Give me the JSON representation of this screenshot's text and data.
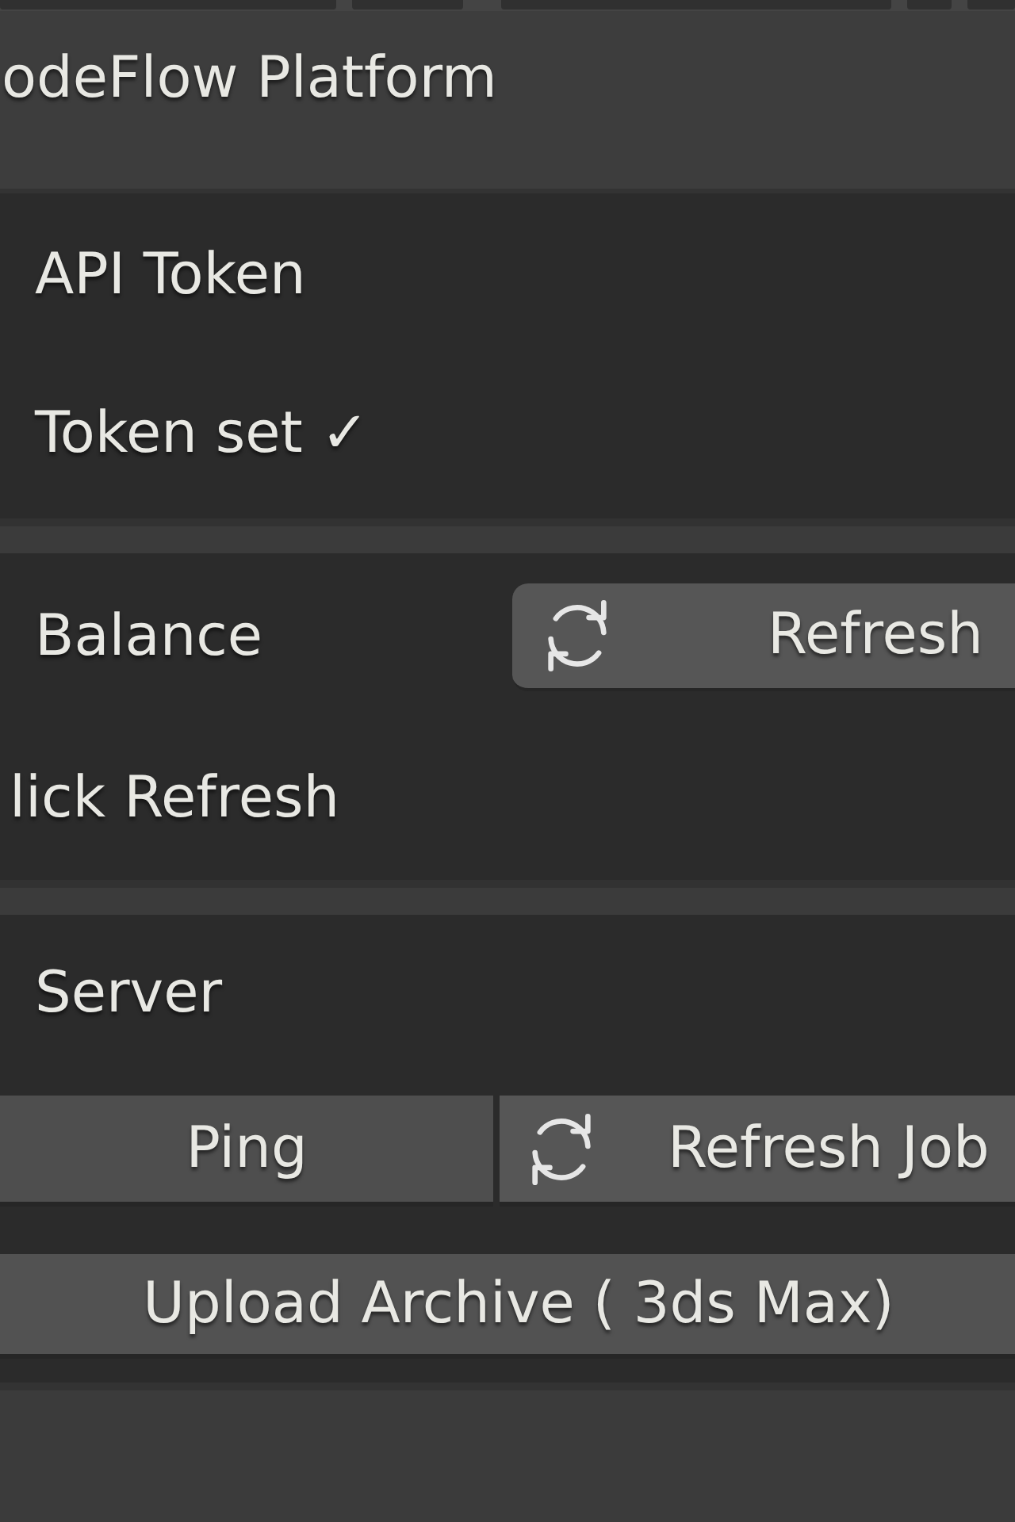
{
  "panel": {
    "title": "odeFlow Platform"
  },
  "sections": [
    {
      "rows": [
        {
          "kind": "label",
          "text": "API Token"
        },
        {
          "kind": "label",
          "text": "Token set ✓"
        }
      ]
    },
    {
      "rows": [
        {
          "kind": "label_button",
          "text": "Balance",
          "button": {
            "kind": "icon",
            "label": "Refresh"
          }
        },
        {
          "kind": "cut_label",
          "text": "lick Refresh"
        }
      ]
    },
    {
      "rows": [
        {
          "kind": "label",
          "text": "Server"
        },
        {
          "kind": "button_pair",
          "buttons": [
            {
              "kind": "plain",
              "label": "Ping"
            },
            {
              "kind": "icon",
              "label": "Refresh Job"
            }
          ]
        },
        {
          "kind": "wide_button",
          "label": "Upload Archive ( 3ds Max)"
        }
      ]
    }
  ]
}
